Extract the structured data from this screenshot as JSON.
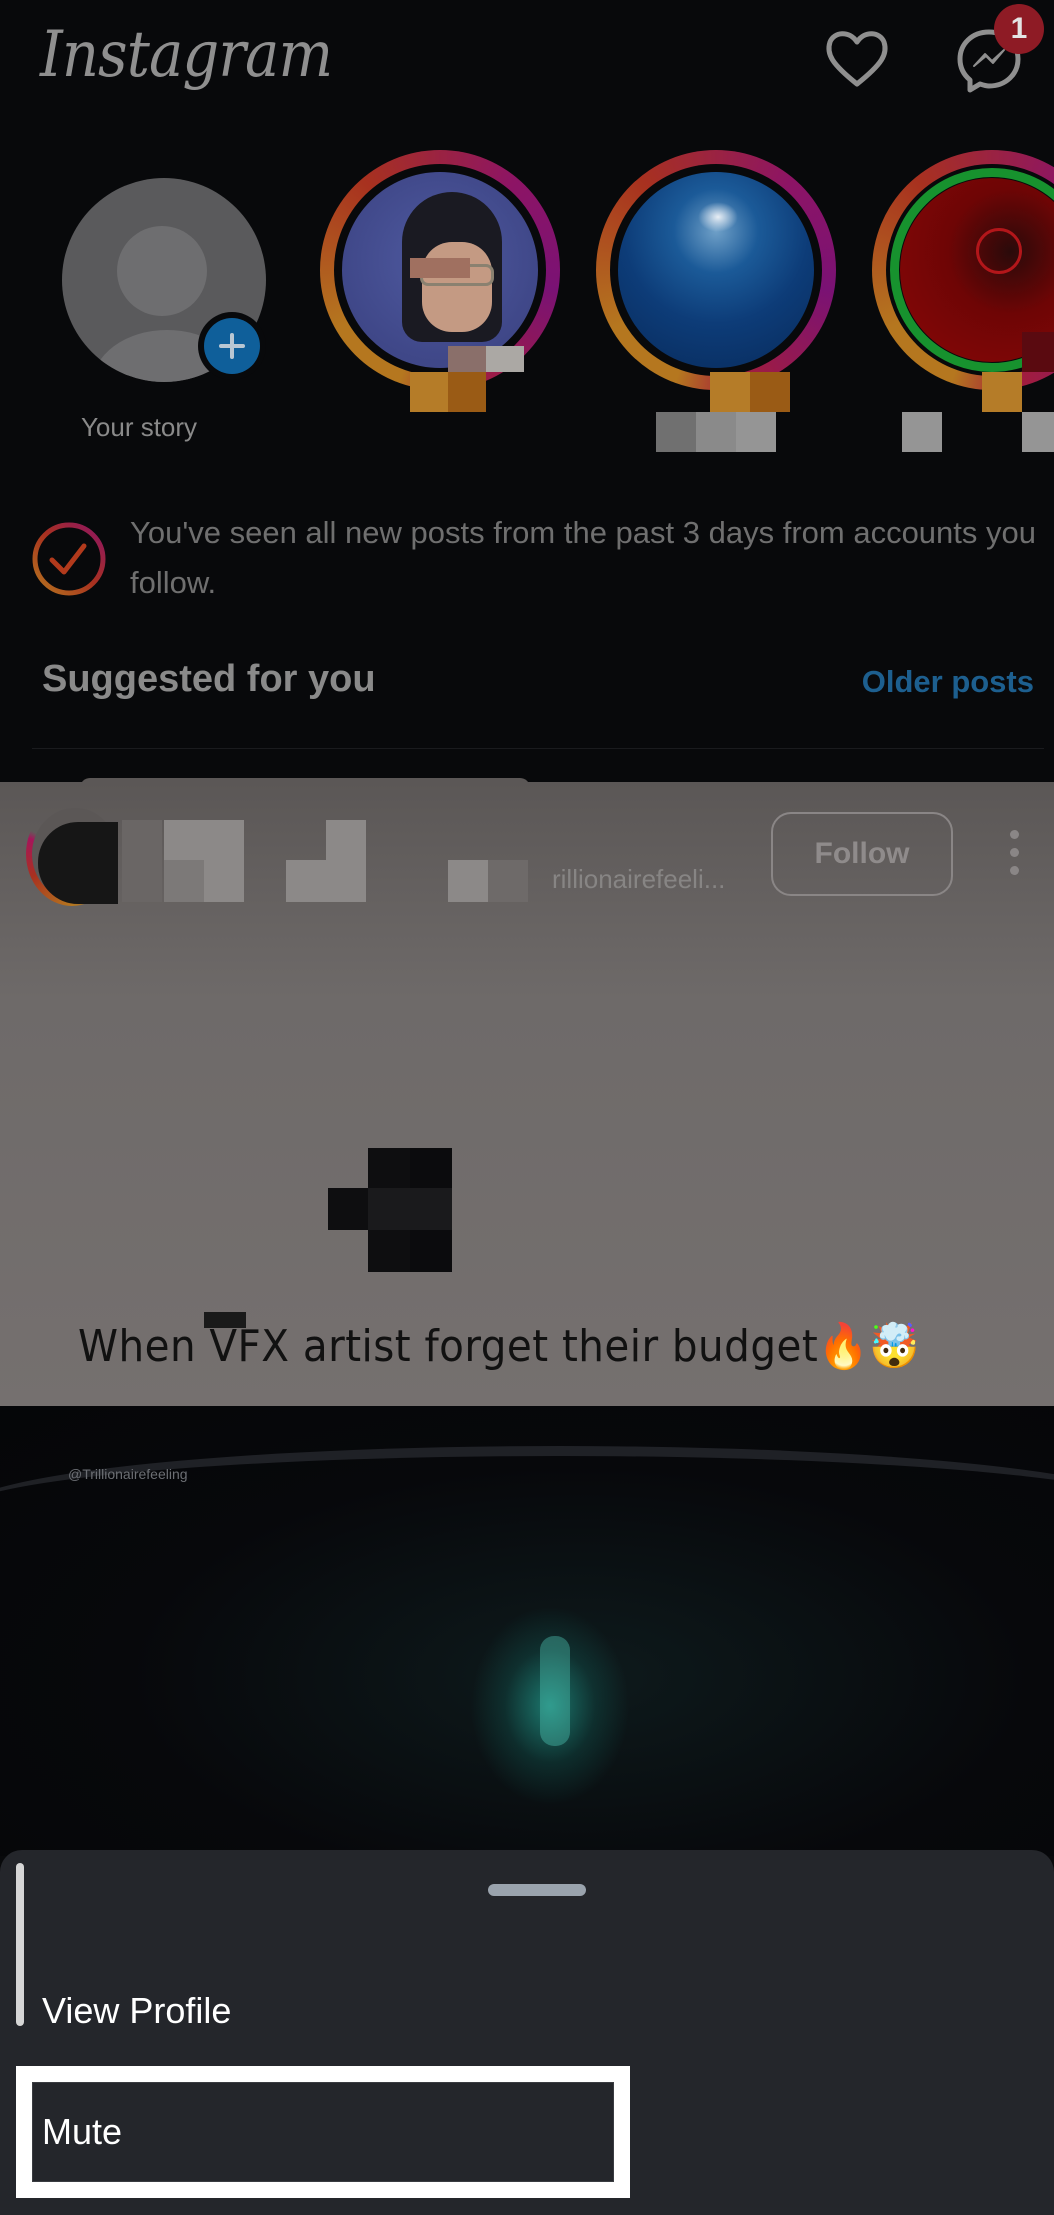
{
  "header": {
    "app_title": "Instagram",
    "activity_icon": "heart-icon",
    "messenger_icon": "messenger-icon",
    "messenger_badge": "1"
  },
  "stories": [
    {
      "label": "Your story",
      "type": "own",
      "add_icon": "plus-icon"
    },
    {
      "label": "",
      "type": "unseen",
      "avatar": "anime-girl-glasses"
    },
    {
      "label": "",
      "type": "unseen",
      "avatar": "earth-globe"
    },
    {
      "label": "",
      "type": "unseen-close-friends",
      "avatar": "red-figure"
    }
  ],
  "caught_up": {
    "icon": "checkmark-circle-icon",
    "message": "You've seen all new posts from the past 3 days from accounts you follow."
  },
  "suggested": {
    "title": "Suggested for you",
    "older_posts_label": "Older posts"
  },
  "post": {
    "handle_partial": "rillionairefeeli...",
    "follow_label": "Follow",
    "more_icon": "more-vertical-icon",
    "caption_overlay": "When VFX artist forget their budget🔥🤯",
    "watermark": "@Trillionairefeeling"
  },
  "bottom_sheet": {
    "items": [
      {
        "label": "View Profile"
      },
      {
        "label": "Mute",
        "highlighted": true
      }
    ]
  },
  "colors": {
    "accent_blue": "#1d5f8f",
    "badge_red": "#8e1b25",
    "sheet_bg": "#24262b"
  }
}
